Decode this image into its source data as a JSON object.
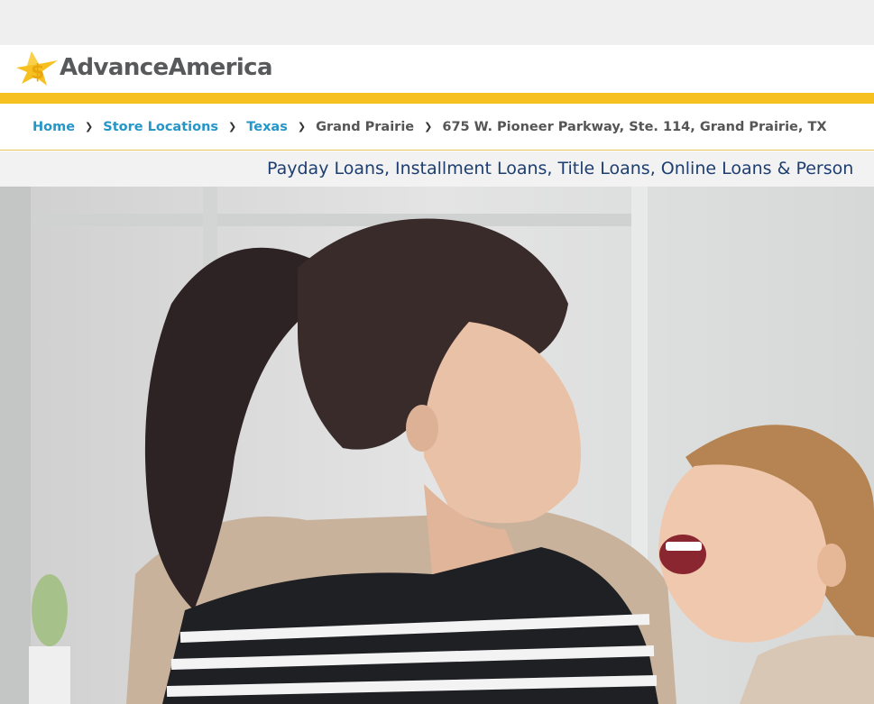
{
  "brand": {
    "name": "AdvanceAmerica",
    "colors": {
      "accent_yellow": "#f6c120",
      "link_blue": "#2596c8",
      "navy": "#1d3e70",
      "logo_gray": "#58595b"
    }
  },
  "breadcrumb": {
    "items": [
      {
        "label": "Home",
        "link": true
      },
      {
        "label": "Store Locations",
        "link": true
      },
      {
        "label": "Texas",
        "link": true
      },
      {
        "label": "Grand Prairie",
        "link": false
      },
      {
        "label": "675 W. Pioneer Parkway, Ste. 114, Grand Prairie, TX",
        "link": false
      }
    ],
    "separator_icon": "chevron-right-icon"
  },
  "tagline": "Payday Loans, Installment Loans, Title Loans, Online Loans & Person",
  "hero": {
    "image": "mother-and-daughter-laughing-photo"
  }
}
